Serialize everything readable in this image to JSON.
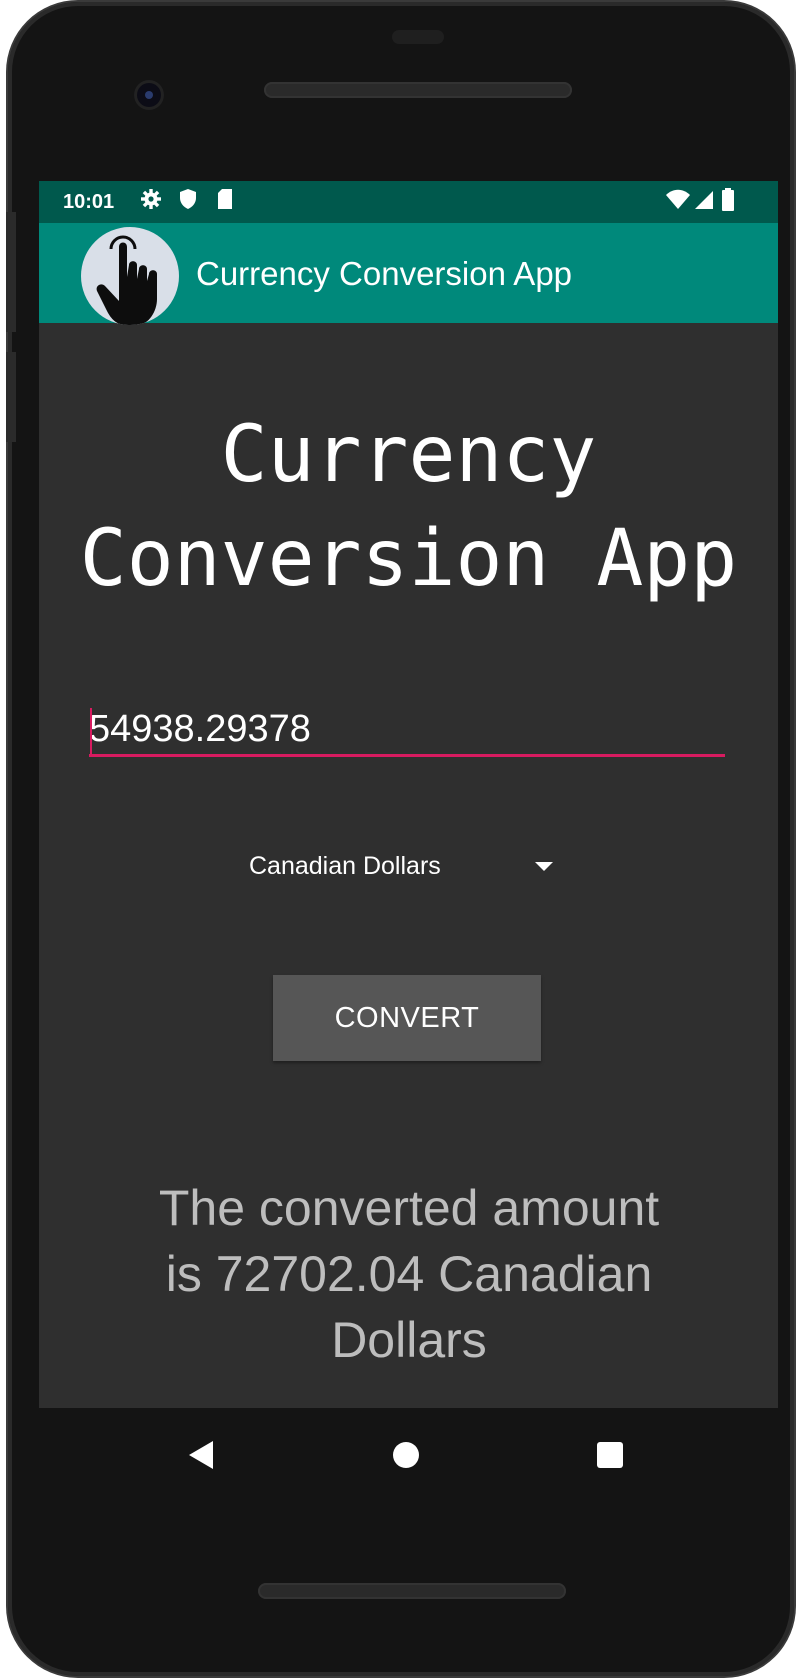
{
  "status_bar": {
    "time": "10:01",
    "left_icons": [
      "gear-icon",
      "shield-icon",
      "sd-card-icon"
    ],
    "right_icons": [
      "wifi-icon",
      "cell-signal-icon",
      "battery-icon"
    ]
  },
  "app_bar": {
    "title": "Currency Conversion App",
    "logo_icon": "touch-hand-icon"
  },
  "main": {
    "headline_line1": "Currency",
    "headline_line2": "Conversion App",
    "amount_value": "54938.29378",
    "currency_selected": "Canadian Dollars",
    "convert_label": "CONVERT",
    "result_line1": "The converted amount",
    "result_line2": "is 72702.04 Canadian",
    "result_line3": "Dollars"
  },
  "nav": {
    "back_icon": "back-triangle-icon",
    "home_icon": "home-circle-icon",
    "recents_icon": "recents-square-icon"
  },
  "colors": {
    "status_bar": "#00594d",
    "app_bar": "#00897b",
    "screen_bg": "#2f2f2f",
    "accent": "#d81b60",
    "button_bg": "#565656",
    "result_text": "#bdbdbd"
  }
}
